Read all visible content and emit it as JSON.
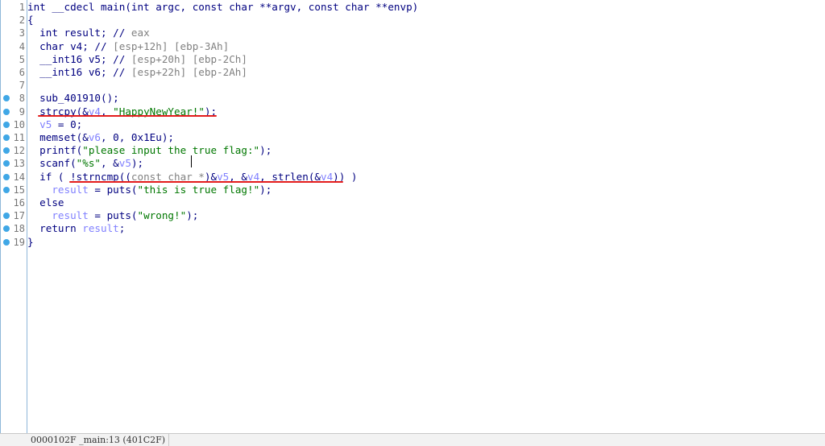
{
  "status_bar": {
    "text": "0000102F _main:13 (401C2F)"
  },
  "lines": [
    {
      "num": "1",
      "bp": false,
      "segs": [
        {
          "t": "int __cdecl main(int argc, const char **argv, const char **envp)",
          "c": "n"
        }
      ]
    },
    {
      "num": "2",
      "bp": false,
      "segs": [
        {
          "t": "{",
          "c": "n"
        }
      ]
    },
    {
      "num": "3",
      "bp": false,
      "segs": [
        {
          "t": "  int result; // ",
          "c": "n"
        },
        {
          "t": "eax",
          "c": "g"
        }
      ]
    },
    {
      "num": "4",
      "bp": false,
      "segs": [
        {
          "t": "  char v4; // ",
          "c": "n"
        },
        {
          "t": "[esp+12h] [ebp-3Ah]",
          "c": "g"
        }
      ]
    },
    {
      "num": "5",
      "bp": false,
      "segs": [
        {
          "t": "  __int16 v5; // ",
          "c": "n"
        },
        {
          "t": "[esp+20h] [ebp-2Ch]",
          "c": "g"
        }
      ]
    },
    {
      "num": "6",
      "bp": false,
      "segs": [
        {
          "t": "  __int16 v6; // ",
          "c": "n"
        },
        {
          "t": "[esp+22h] [ebp-2Ah]",
          "c": "g"
        }
      ]
    },
    {
      "num": "7",
      "bp": false,
      "segs": [
        {
          "t": "",
          "c": "n"
        }
      ]
    },
    {
      "num": "8",
      "bp": true,
      "segs": [
        {
          "t": "  sub_401910();",
          "c": "n"
        }
      ]
    },
    {
      "num": "9",
      "bp": true,
      "segs": [
        {
          "t": "  strcpy(&",
          "c": "n"
        },
        {
          "t": "v4",
          "c": "v"
        },
        {
          "t": ", ",
          "c": "n"
        },
        {
          "t": "\"HappyNewYear!\"",
          "c": "s"
        },
        {
          "t": ");",
          "c": "n"
        }
      ]
    },
    {
      "num": "10",
      "bp": true,
      "segs": [
        {
          "t": "  ",
          "c": "n"
        },
        {
          "t": "v5",
          "c": "v"
        },
        {
          "t": " = 0;",
          "c": "n"
        }
      ]
    },
    {
      "num": "11",
      "bp": true,
      "segs": [
        {
          "t": "  memset(&",
          "c": "n"
        },
        {
          "t": "v6",
          "c": "v"
        },
        {
          "t": ", 0, 0x1Eu);",
          "c": "n"
        }
      ]
    },
    {
      "num": "12",
      "bp": true,
      "segs": [
        {
          "t": "  printf(",
          "c": "n"
        },
        {
          "t": "\"please input the true flag:\"",
          "c": "s"
        },
        {
          "t": ");",
          "c": "n"
        }
      ]
    },
    {
      "num": "13",
      "bp": true,
      "segs": [
        {
          "t": "  scanf(",
          "c": "n"
        },
        {
          "t": "\"%s\"",
          "c": "s"
        },
        {
          "t": ", &",
          "c": "n"
        },
        {
          "t": "v5",
          "c": "v"
        },
        {
          "t": ");",
          "c": "n"
        }
      ]
    },
    {
      "num": "14",
      "bp": true,
      "segs": [
        {
          "t": "  if ( !strncmp((",
          "c": "n"
        },
        {
          "t": "const char *",
          "c": "g"
        },
        {
          "t": ")&",
          "c": "n"
        },
        {
          "t": "v5",
          "c": "v"
        },
        {
          "t": ", &",
          "c": "n"
        },
        {
          "t": "v4",
          "c": "v"
        },
        {
          "t": ", strlen(&",
          "c": "n"
        },
        {
          "t": "v4",
          "c": "v"
        },
        {
          "t": ")) )",
          "c": "n"
        }
      ]
    },
    {
      "num": "15",
      "bp": true,
      "segs": [
        {
          "t": "    ",
          "c": "n"
        },
        {
          "t": "result",
          "c": "v"
        },
        {
          "t": " = puts(",
          "c": "n"
        },
        {
          "t": "\"this is true flag!\"",
          "c": "s"
        },
        {
          "t": ");",
          "c": "n"
        }
      ]
    },
    {
      "num": "16",
      "bp": false,
      "segs": [
        {
          "t": "  else",
          "c": "n"
        }
      ]
    },
    {
      "num": "17",
      "bp": true,
      "segs": [
        {
          "t": "    ",
          "c": "n"
        },
        {
          "t": "result",
          "c": "v"
        },
        {
          "t": " = puts(",
          "c": "n"
        },
        {
          "t": "\"wrong!\"",
          "c": "s"
        },
        {
          "t": ");",
          "c": "n"
        }
      ]
    },
    {
      "num": "18",
      "bp": true,
      "segs": [
        {
          "t": "  return ",
          "c": "n"
        },
        {
          "t": "result",
          "c": "v"
        },
        {
          "t": ";",
          "c": "n"
        }
      ]
    },
    {
      "num": "19",
      "bp": true,
      "segs": [
        {
          "t": "}",
          "c": "n"
        }
      ]
    }
  ],
  "colors": {
    "keyword": "#000080",
    "comment": "#808080",
    "variable": "#8080ff",
    "string": "#007700",
    "breakpoint": "#3fa7e6",
    "annotation": "#e31b1b"
  }
}
